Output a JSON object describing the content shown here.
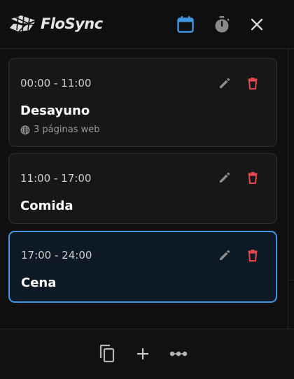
{
  "app": {
    "name": "FloSync",
    "colors": {
      "accent": "#3d97e6",
      "danger": "#e5484d",
      "background": "#0f0f10",
      "card": "#171718",
      "card_active": "#0d1a26"
    }
  },
  "header": {
    "logo_icon": "flosync-logo-icon",
    "buttons": [
      {
        "icon": "calendar-icon",
        "active": true
      },
      {
        "icon": "timer-icon",
        "active": false
      },
      {
        "icon": "close-icon",
        "active": false
      }
    ]
  },
  "schedule": {
    "items": [
      {
        "time": "00:00 - 11:00",
        "name": "Desayuno",
        "meta": "3 páginas web",
        "meta_icon": "globe-icon",
        "selected": false
      },
      {
        "time": "11:00 - 17:00",
        "name": "Comida",
        "meta": "",
        "selected": false
      },
      {
        "time": "17:00 - 24:00",
        "name": "Cena",
        "meta": "",
        "selected": true
      }
    ],
    "item_actions": [
      "edit-icon",
      "delete-icon"
    ]
  },
  "footer": {
    "buttons": [
      "copy-icon",
      "plus-icon",
      "more-icon"
    ]
  }
}
